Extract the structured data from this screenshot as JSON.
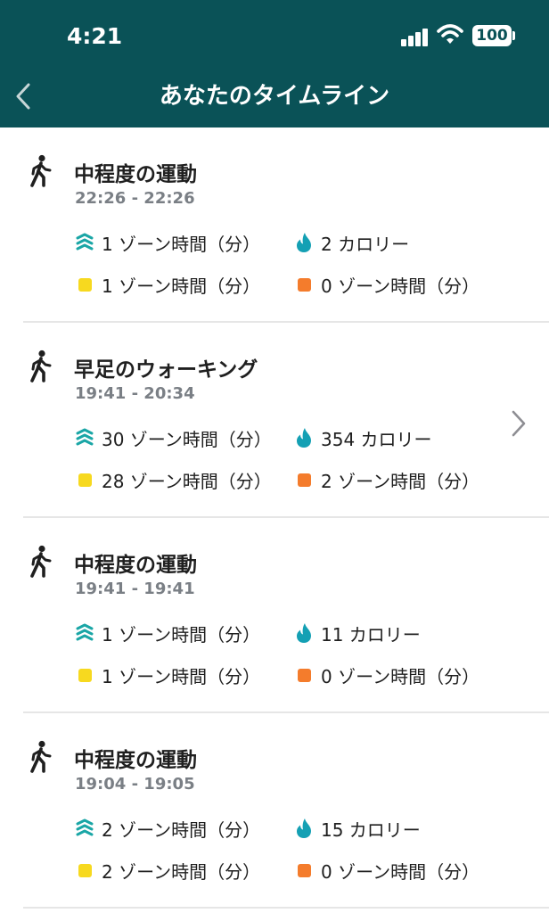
{
  "status_bar": {
    "time": "4:21",
    "battery": "100"
  },
  "header": {
    "title": "あなたのタイムライン"
  },
  "colors": {
    "header_bg": "#0a5257",
    "zone_teal": "#1aa6a6",
    "calorie_teal": "#14a0b4",
    "fat_burn_yellow": "#f7d91f",
    "cardio_orange": "#f47c2c"
  },
  "cards": [
    {
      "title": "中程度の運動",
      "time": "22:26 - 22:26",
      "zone_minutes": "1 ゾーン時間（分）",
      "calories": "2 カロリー",
      "fat_burn": "1 ゾーン時間（分）",
      "cardio": "0 ゾーン時間（分）",
      "has_chevron": false
    },
    {
      "title": "早足のウォーキング",
      "time": "19:41 - 20:34",
      "zone_minutes": "30 ゾーン時間（分）",
      "calories": "354 カロリー",
      "fat_burn": "28 ゾーン時間（分）",
      "cardio": "2 ゾーン時間（分）",
      "has_chevron": true
    },
    {
      "title": "中程度の運動",
      "time": "19:41 - 19:41",
      "zone_minutes": "1 ゾーン時間（分）",
      "calories": "11 カロリー",
      "fat_burn": "1 ゾーン時間（分）",
      "cardio": "0 ゾーン時間（分）",
      "has_chevron": false
    },
    {
      "title": "中程度の運動",
      "time": "19:04 - 19:05",
      "zone_minutes": "2 ゾーン時間（分）",
      "calories": "15 カロリー",
      "fat_burn": "2 ゾーン時間（分）",
      "cardio": "0 ゾーン時間（分）",
      "has_chevron": false
    }
  ]
}
